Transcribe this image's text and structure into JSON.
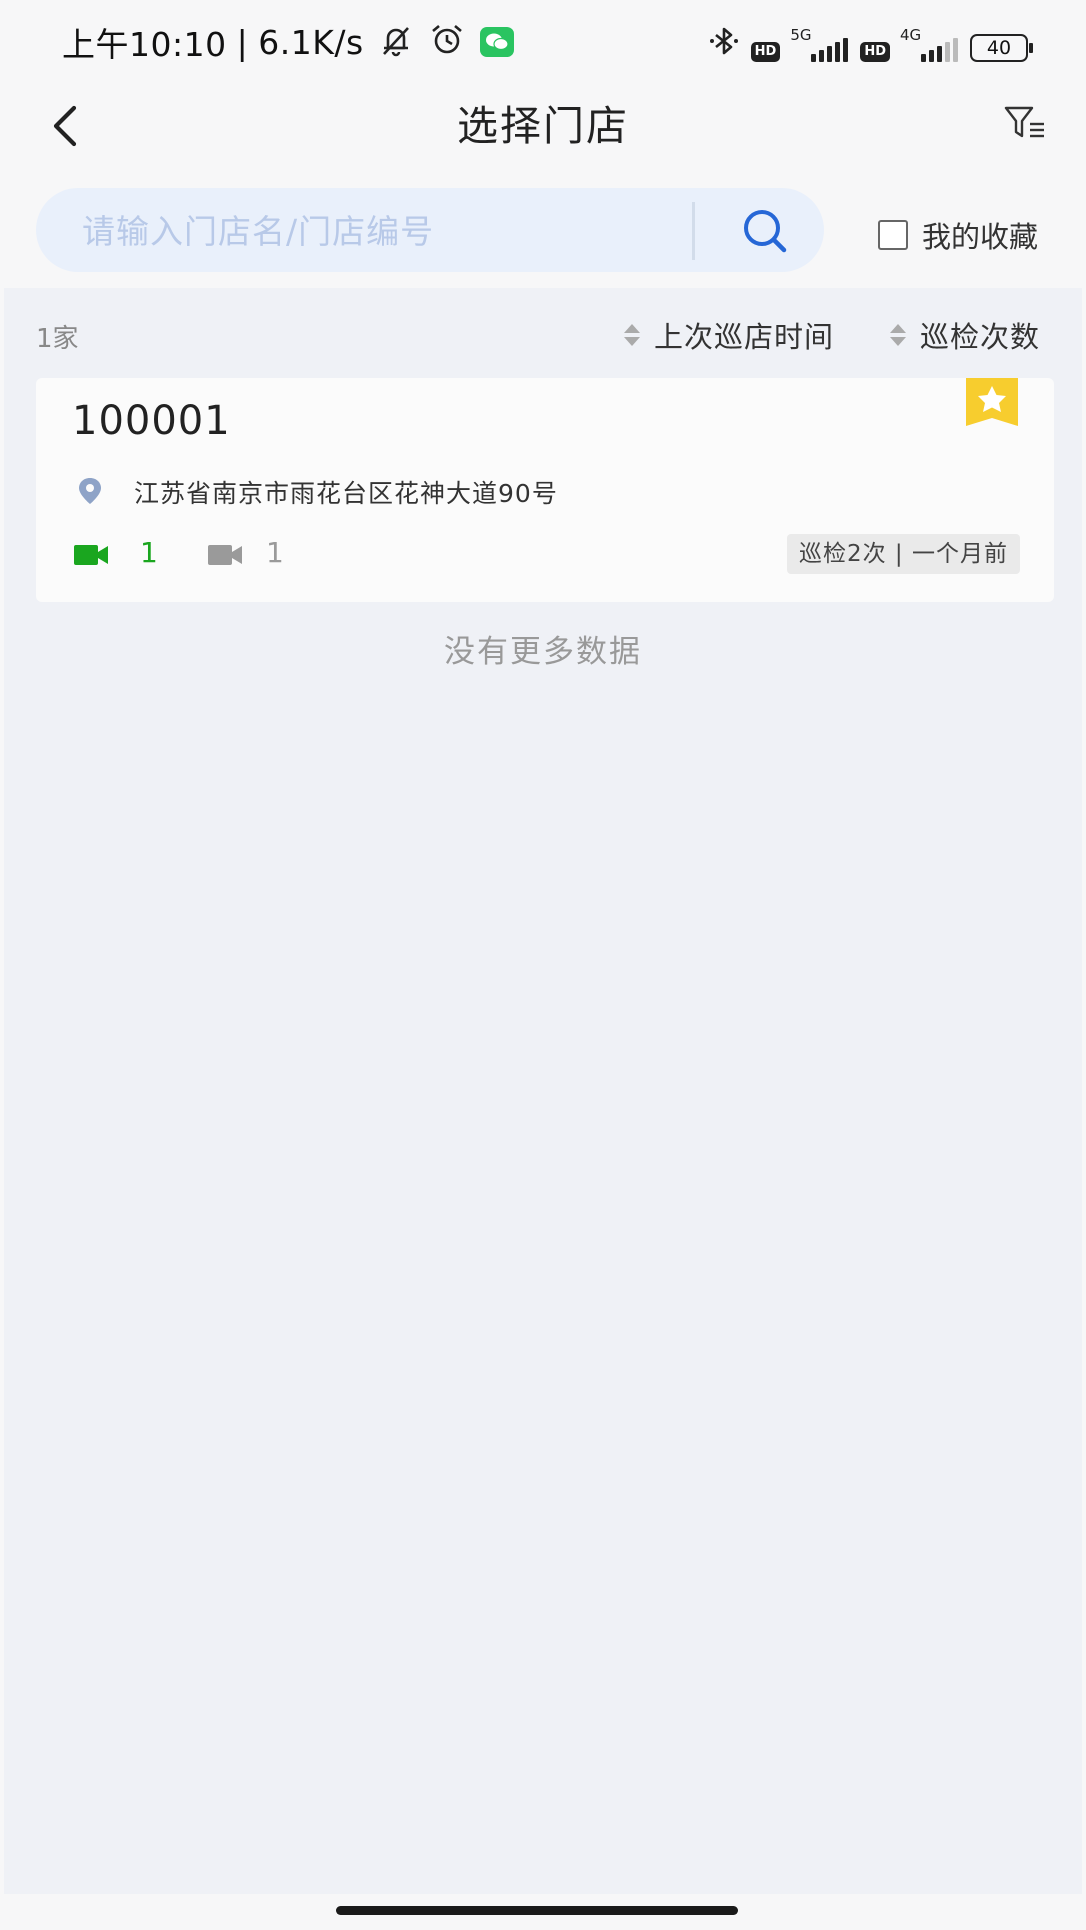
{
  "status_bar": {
    "time": "上午10:10",
    "separator": "|",
    "net_speed": "6.1K/s",
    "left_icons": [
      "bell-off-icon",
      "alarm-clock-icon",
      "wechat-icon"
    ],
    "right_icons": [
      "bluetooth-icon",
      "hd-icon",
      "signal-5g-icon",
      "hd-icon",
      "signal-4g-icon",
      "battery-icon"
    ],
    "hd_label": "HD",
    "sim1_label": "5G",
    "sim2_label": "4G",
    "battery": "40"
  },
  "header": {
    "title": "选择门店",
    "back_icon": "chevron-left-icon",
    "filter_icon": "filter-list-icon"
  },
  "search": {
    "placeholder": "请输入门店名/门店编号",
    "value": "",
    "icon": "search-icon",
    "favorite_label": "我的收藏",
    "favorite_checked": false
  },
  "list": {
    "count_label": "1家",
    "sort_options": [
      {
        "label": "上次巡店时间",
        "icon": "sort-arrows-icon"
      },
      {
        "label": "巡检次数",
        "icon": "sort-arrows-icon"
      }
    ],
    "stores": [
      {
        "id": "100001",
        "favorited": true,
        "address": "江苏省南京市雨花台区花神大道90号",
        "online_cameras": "1",
        "offline_cameras": "1",
        "inspection": "巡检2次 | 一个月前"
      }
    ],
    "footer": "没有更多数据"
  },
  "colors": {
    "accent_blue": "#2667d6",
    "online_green": "#1aa61f",
    "offline_gray": "#9a9a9a",
    "favorite_yellow": "#f7cd2e",
    "wechat_green": "#2ac461",
    "search_bg": "#e9f0fb",
    "list_bg": "#eff1f6"
  }
}
